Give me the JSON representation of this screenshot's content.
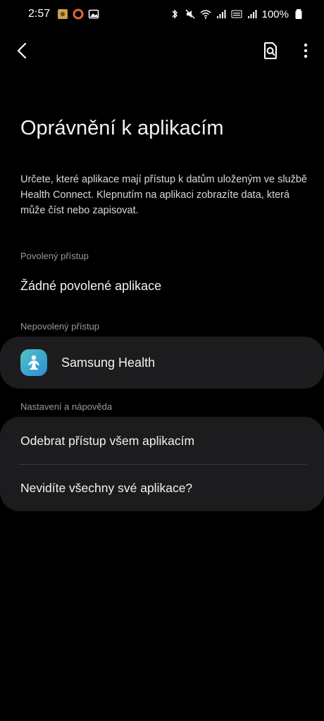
{
  "status_bar": {
    "time": "2:57",
    "battery": "100%"
  },
  "page": {
    "title": "Oprávnění k aplikacím",
    "description": "Určete, které aplikace mají přístup k datům uloženým ve službě Health Connect. Klepnutím na aplikaci zobrazíte data, která může číst nebo zapisovat."
  },
  "sections": {
    "allowed_header": "Povolený přístup",
    "allowed_empty": "Žádné povolené aplikace",
    "denied_header": "Nepovolený přístup",
    "settings_header": "Nastavení a nápověda"
  },
  "denied_apps": [
    {
      "name": "Samsung Health",
      "icon": "samsung-health-icon"
    }
  ],
  "settings_items": [
    {
      "label": "Odebrat přístup všem aplikacím"
    },
    {
      "label": "Nevidíte všechny své aplikace?"
    }
  ],
  "icons": {
    "back": "chevron-left-icon",
    "search": "search-in-page-icon",
    "more": "more-vertical-icon"
  },
  "colors": {
    "background": "#000000",
    "card": "#1c1c1e",
    "section_header": "#9a9a9a"
  }
}
